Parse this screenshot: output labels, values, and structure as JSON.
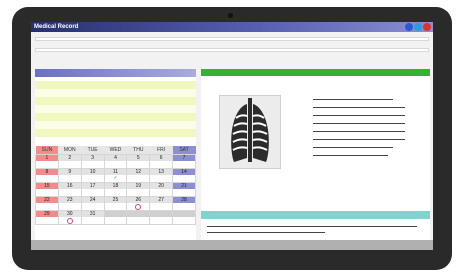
{
  "window": {
    "title": "Medical Record",
    "buttons": [
      {
        "name": "window-button-blue",
        "color": "#2b59d6"
      },
      {
        "name": "window-button-teal",
        "color": "#2a9fd6"
      },
      {
        "name": "window-button-red",
        "color": "#e03030"
      }
    ]
  },
  "calendar": {
    "days": [
      "SUN",
      "MON",
      "TUE",
      "WED",
      "THU",
      "FRI",
      "SAT"
    ],
    "weeks": [
      [
        "1",
        "2",
        "3",
        "4",
        "5",
        "6",
        "7"
      ],
      [
        "8",
        "9",
        "10",
        "11",
        "12",
        "13",
        "14"
      ],
      [
        "15",
        "16",
        "17",
        "18",
        "19",
        "20",
        "21"
      ],
      [
        "22",
        "23",
        "24",
        "25",
        "26",
        "27",
        "28"
      ],
      [
        "29",
        "30",
        "31",
        "",
        "",
        "",
        ""
      ]
    ]
  },
  "colors": {
    "green_header": "#32b432",
    "teal_header": "#7fd4cf",
    "sunday": "#f28c8c",
    "saturday": "#8d8fd2",
    "checkmark": "#2aa82a",
    "circle_marker": "#e0407a"
  }
}
